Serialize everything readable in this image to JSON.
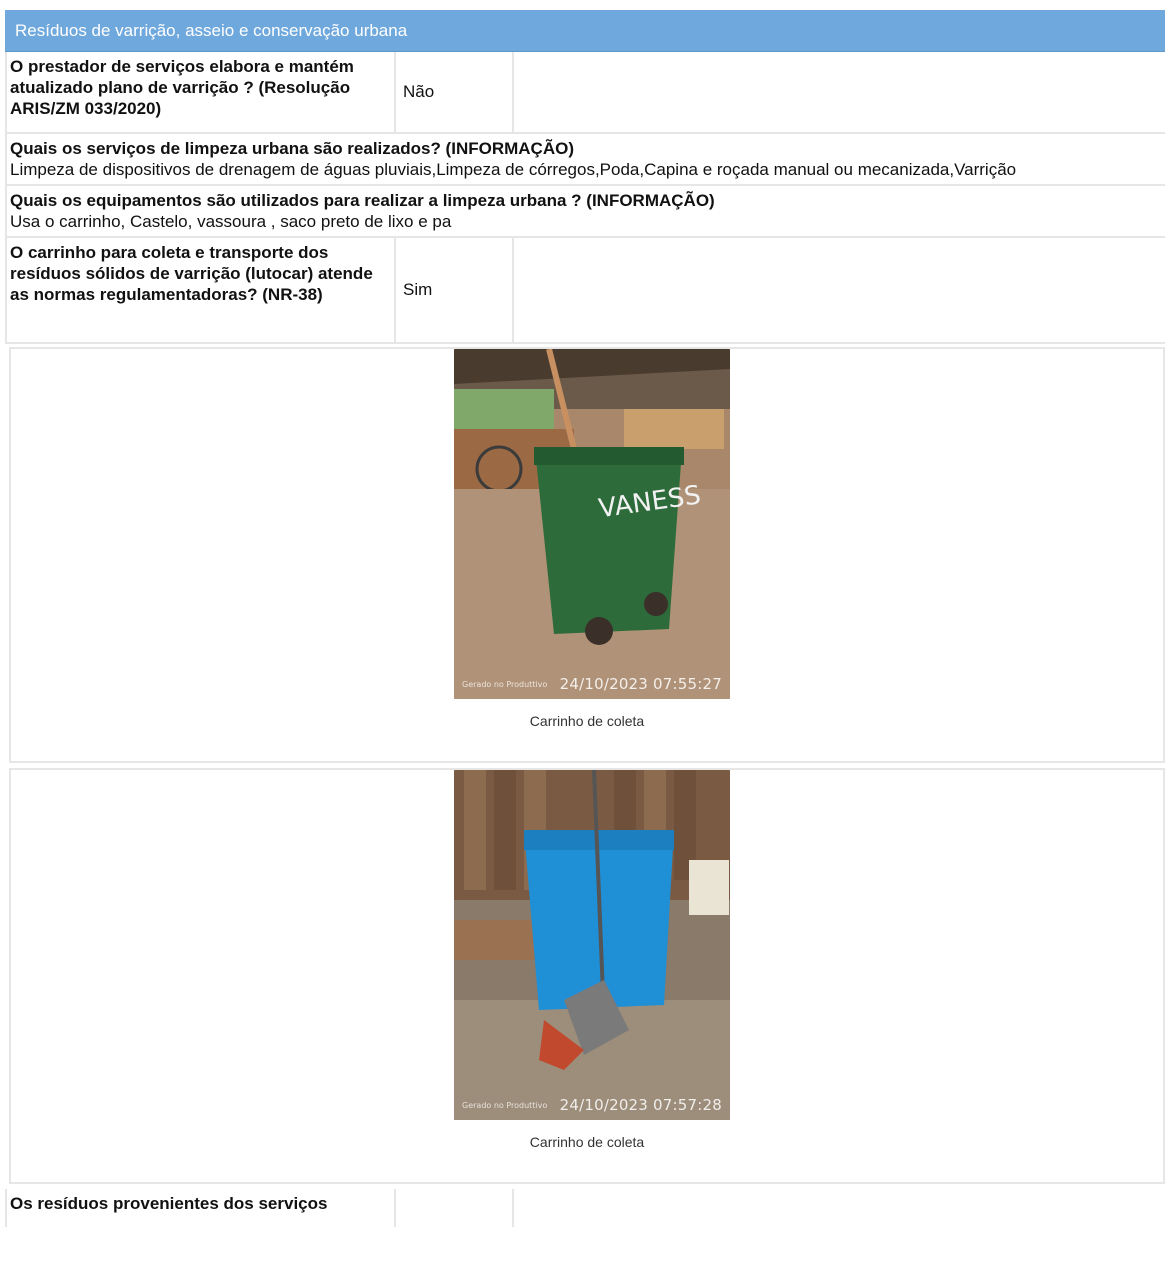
{
  "section": {
    "title": "Resíduos de varrição, asseio e conservação urbana"
  },
  "rows": [
    {
      "question": "O prestador de serviços elabora e mantém atualizado plano de varrição ? (Resolução ARIS/ZM 033/2020)",
      "answer": "Não"
    },
    {
      "question": "O carrinho para coleta e transporte dos resíduos sólidos de varrição (lutocar) atende as normas regulamentadoras? (NR-38)",
      "answer": "Sim"
    },
    {
      "question": "Os resíduos provenientes dos serviços",
      "answer": ""
    }
  ],
  "info": [
    {
      "title": "Quais os serviços de limpeza urbana são realizados? (INFORMAÇÃO)",
      "value": "Limpeza de dispositivos de drenagem de águas pluviais,Limpeza de córregos,Poda,Capina e roçada manual ou mecanizada,Varrição"
    },
    {
      "title": "Quais os equipamentos são utilizados para realizar a limpeza urbana ? (INFORMAÇÃO)",
      "value": "Usa o carrinho, Castelo, vassoura , saco preto de lixo e pa"
    }
  ],
  "photos": [
    {
      "caption": "Carrinho de coleta",
      "timestamp": "24/10/2023 07:55:27",
      "watermark": "Gerado no Produttivo",
      "bin_text": "VANESS",
      "bin_color": "#2e6b3a"
    },
    {
      "caption": "Carrinho de coleta",
      "timestamp": "24/10/2023 07:57:28",
      "watermark": "Gerado no Produttivo",
      "bin_color": "#1f8fd6"
    }
  ],
  "colors": {
    "header_bg": "#6fa8dc",
    "border": "#e6e6e6"
  }
}
